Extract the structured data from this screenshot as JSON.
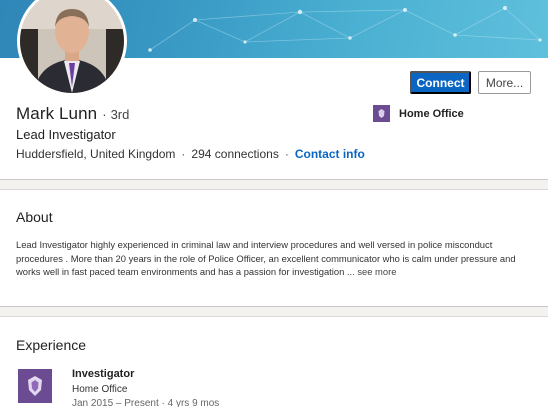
{
  "profile": {
    "name": "Mark Lunn",
    "degree_separator": "·",
    "degree": "3rd",
    "headline": "Lead Investigator",
    "location": "Huddersfield, United Kingdom",
    "connections": "294 connections",
    "contact_info": "Contact info",
    "separator": "·",
    "current_org": {
      "name": "Home Office",
      "logo_icon": "home-office-crest-icon"
    },
    "avatar_icon": "profile-photo"
  },
  "actions": {
    "connect_label": "Connect",
    "more_label": "More..."
  },
  "about": {
    "title": "About",
    "text": "Lead Investigator highly experienced in criminal law and interview procedures and well versed in police misconduct procedures . More than 20 years in the role of Police Officer, an excellent communicator who is calm under pressure and works well in fast paced team environments and has a passion for investigation",
    "see_more": "... see more"
  },
  "experience": {
    "title": "Experience",
    "items": [
      {
        "title": "Investigator",
        "company": "Home Office",
        "dates": "Jan 2015 – Present · 4 yrs 9 mos",
        "logo_icon": "home-office-crest-icon"
      }
    ]
  },
  "colors": {
    "accent": "#0a66c2",
    "org_purple": "#6b4c93",
    "banner": "#3a9bc5"
  }
}
